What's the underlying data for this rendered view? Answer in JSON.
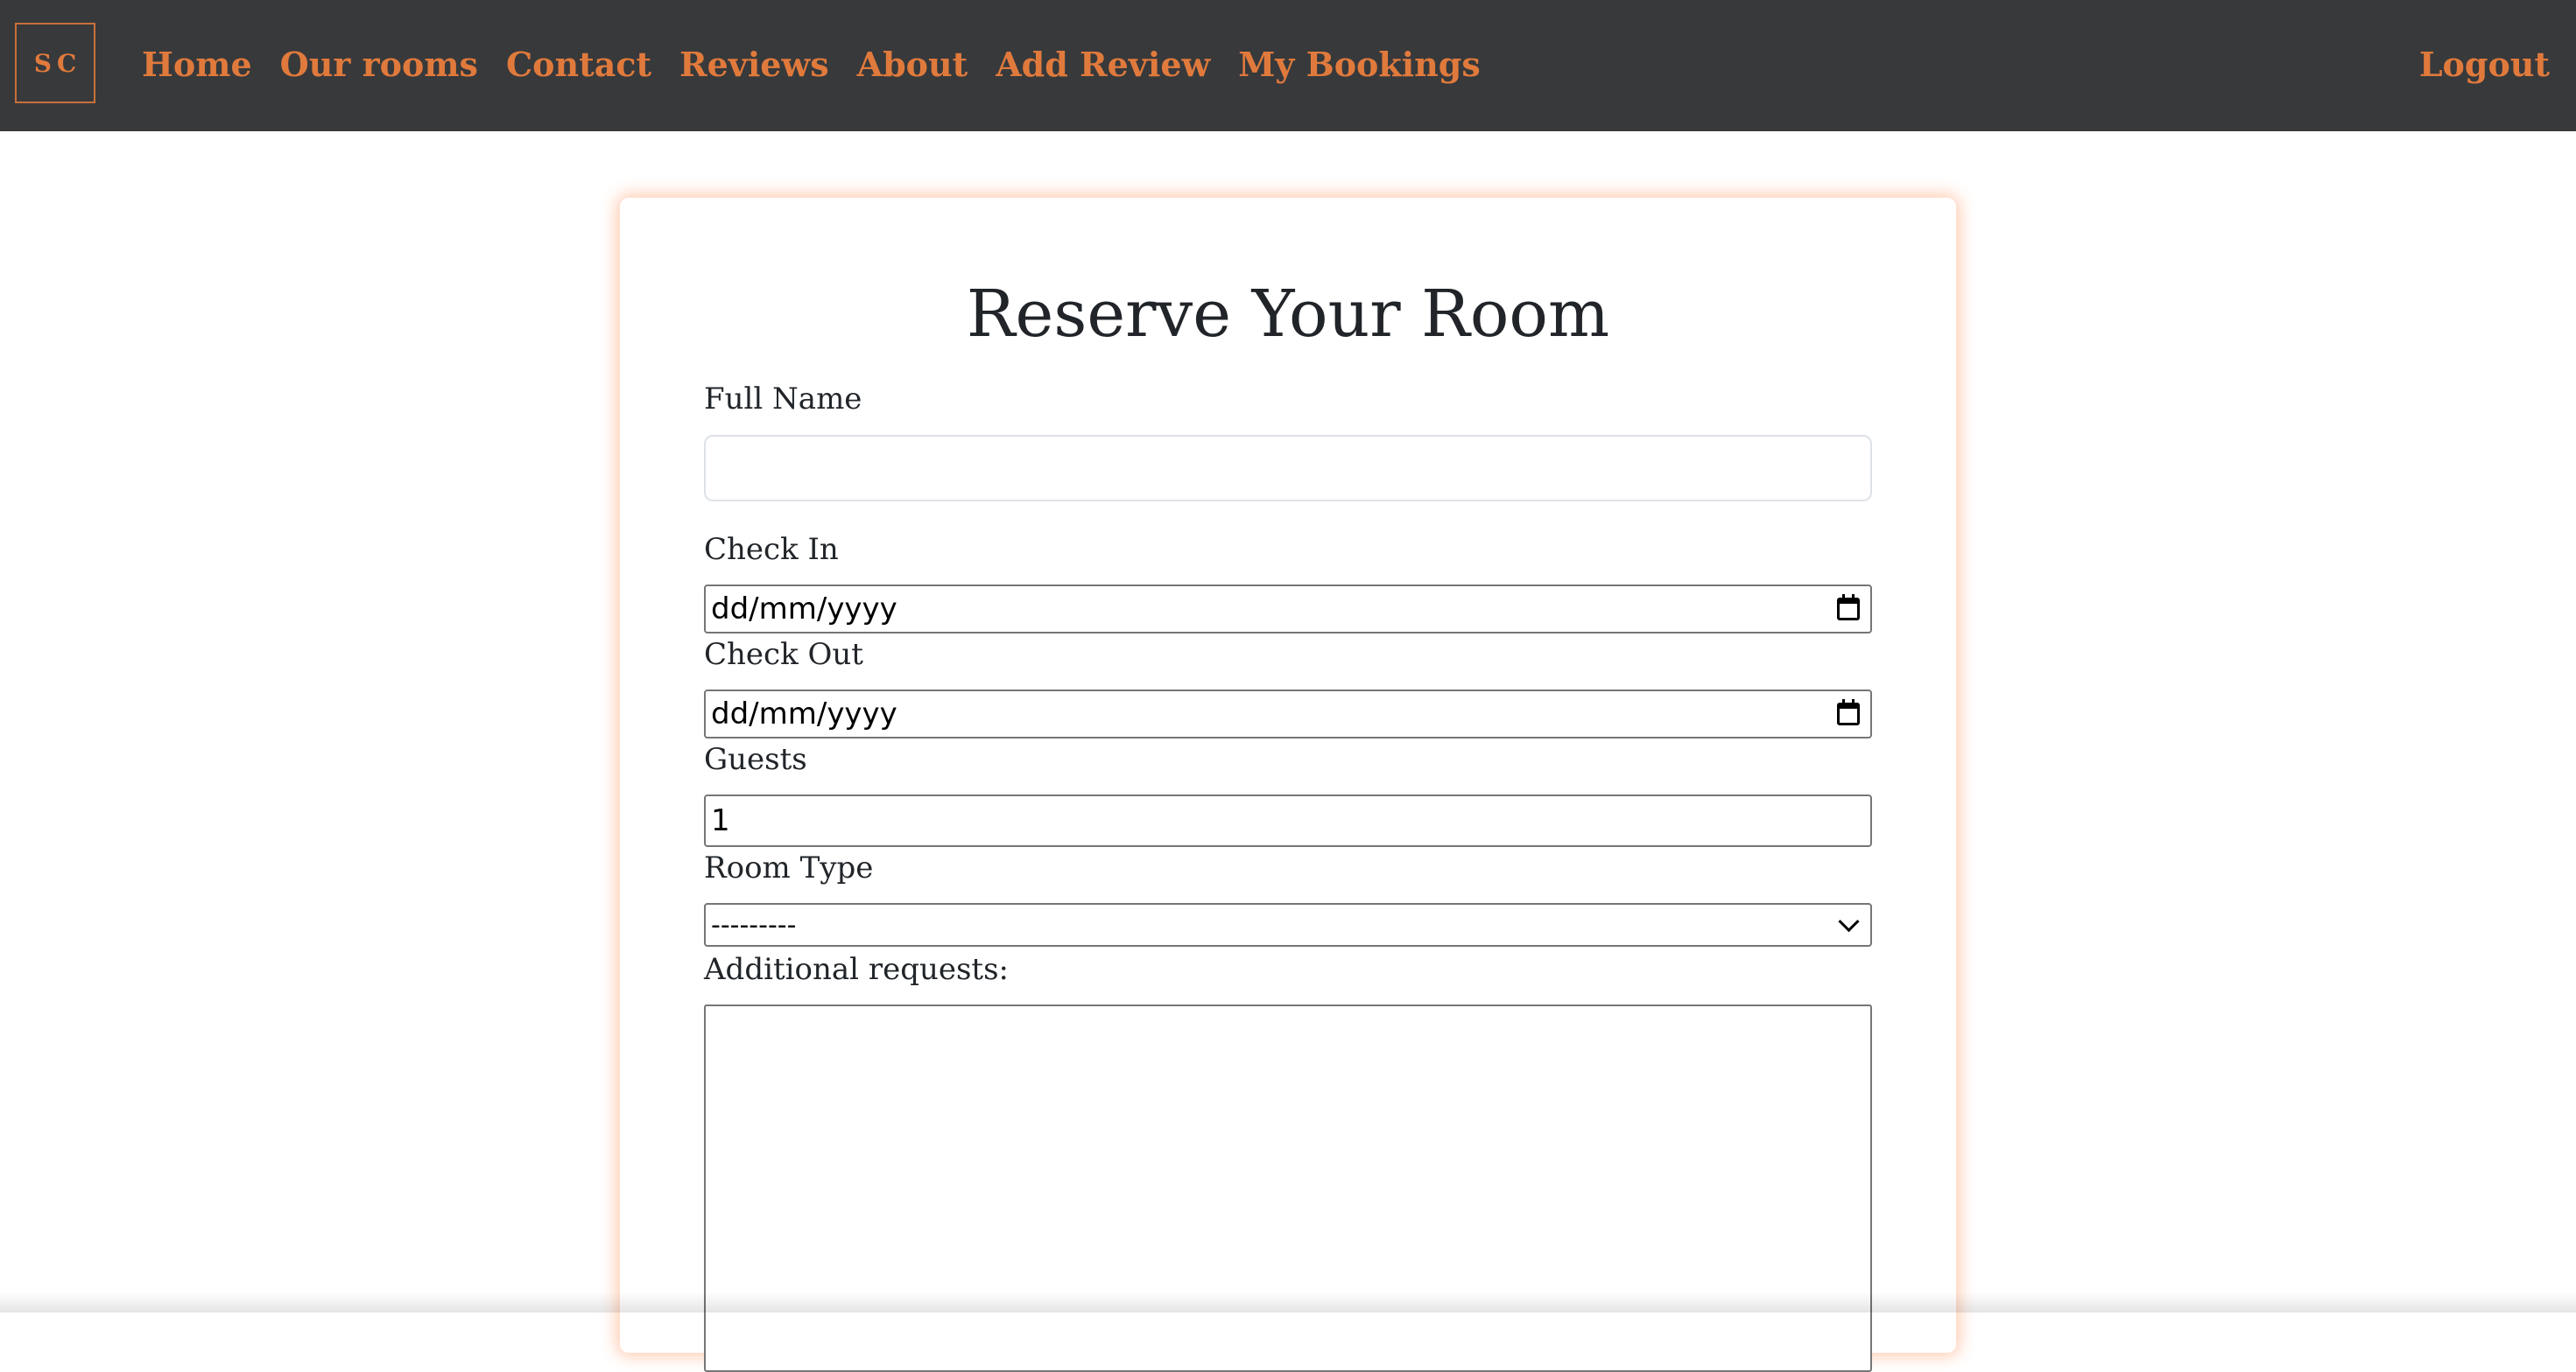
{
  "nav": {
    "logo_text": "SC",
    "links": [
      "Home",
      "Our rooms",
      "Contact",
      "Reviews",
      "About",
      "Add Review",
      "My Bookings"
    ],
    "logout": "Logout"
  },
  "form": {
    "title": "Reserve Your Room",
    "full_name_label": "Full Name",
    "full_name_value": "",
    "check_in_label": "Check In",
    "check_in_value": "dd/mm/yyyy",
    "check_out_label": "Check Out",
    "check_out_value": "dd/mm/yyyy",
    "guests_label": "Guests",
    "guests_value": "1",
    "room_type_label": "Room Type",
    "room_type_value": "---------",
    "requests_label": "Additional requests:",
    "requests_value": ""
  },
  "colors": {
    "navbar_bg": "#38393b",
    "accent": "#e07a3c",
    "card_glow": "#ff8c50"
  },
  "icons": [
    "calendar-icon",
    "chevron-down-icon"
  ]
}
